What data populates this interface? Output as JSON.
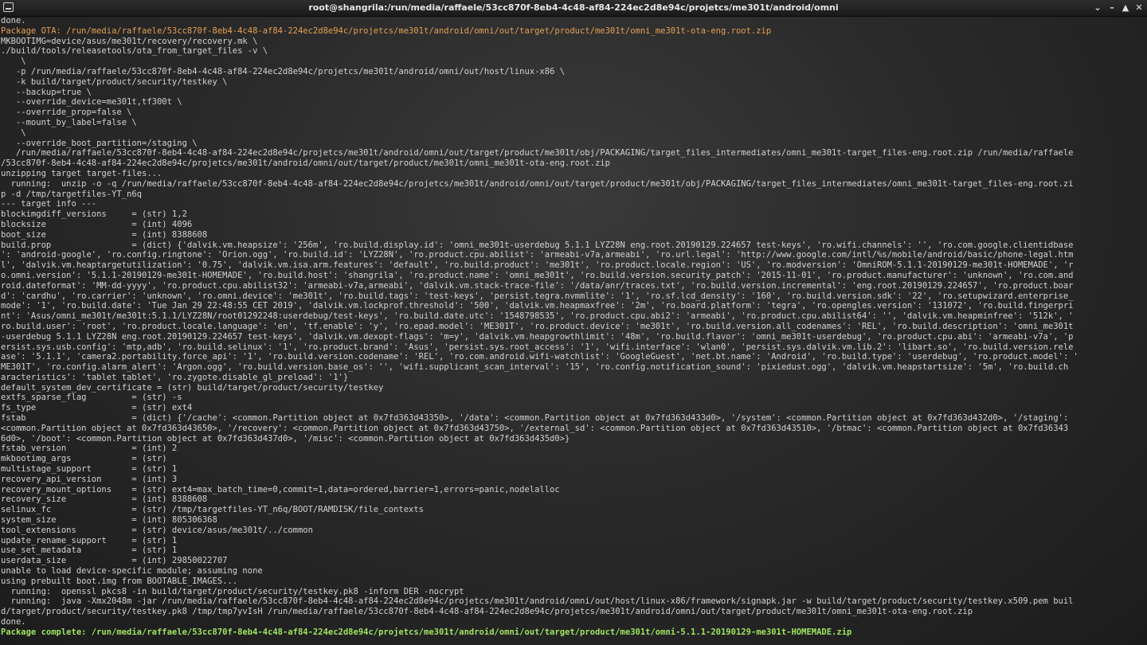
{
  "window": {
    "title": "root@shangrila:/run/media/raffaele/53cc870f-8eb4-4c48-af84-224ec2d8e94c/projetcs/me301t/android/omni",
    "icons": {
      "app": "terminal-icon",
      "menu": "chevron-down-icon",
      "minimize": "minimize-icon",
      "maximize": "maximize-icon",
      "close": "close-icon"
    },
    "glyphs": {
      "menu": "⌄",
      "minimize": "–",
      "maximize": "▲",
      "close": "✕"
    }
  },
  "colors": {
    "text": "#d2d2d2",
    "highlight_orange": "#e5a055",
    "highlight_green": "#9fe560",
    "background": "#2a2a2a"
  },
  "terminal": {
    "lines": [
      {
        "text": "done.",
        "style": "normal"
      },
      {
        "text": "Package OTA: /run/media/raffaele/53cc870f-8eb4-4c48-af84-224ec2d8e94c/projetcs/me301t/android/omni/out/target/product/me301t/omni_me301t-ota-eng.root.zip",
        "style": "orange"
      },
      {
        "text": "MKBOOTIMG=device/asus/me301t/recovery/recovery.mk \\",
        "style": "normal"
      },
      {
        "text": "./build/tools/releasetools/ota_from_target_files -v \\",
        "style": "normal"
      },
      {
        "text": "    \\",
        "style": "normal"
      },
      {
        "text": "   -p /run/media/raffaele/53cc870f-8eb4-4c48-af84-224ec2d8e94c/projetcs/me301t/android/omni/out/host/linux-x86 \\",
        "style": "normal"
      },
      {
        "text": "   -k build/target/product/security/testkey \\",
        "style": "normal"
      },
      {
        "text": "   --backup=true \\",
        "style": "normal"
      },
      {
        "text": "   --override_device=me301t,tf300t \\",
        "style": "normal"
      },
      {
        "text": "   --override_prop=false \\",
        "style": "normal"
      },
      {
        "text": "   --mount_by_label=false \\",
        "style": "normal"
      },
      {
        "text": "    \\",
        "style": "normal"
      },
      {
        "text": "   --override_boot_partition=/staging \\",
        "style": "normal"
      },
      {
        "text": "   /run/media/raffaele/53cc870f-8eb4-4c48-af84-224ec2d8e94c/projetcs/me301t/android/omni/out/target/product/me301t/obj/PACKAGING/target_files_intermediates/omni_me301t-target_files-eng.root.zip /run/media/raffaele",
        "style": "normal"
      },
      {
        "text": "/53cc870f-8eb4-4c48-af84-224ec2d8e94c/projetcs/me301t/android/omni/out/target/product/me301t/omni_me301t-ota-eng.root.zip",
        "style": "normal"
      },
      {
        "text": "unzipping target target-files...",
        "style": "normal"
      },
      {
        "text": "  running:  unzip -o -q /run/media/raffaele/53cc870f-8eb4-4c48-af84-224ec2d8e94c/projetcs/me301t/android/omni/out/target/product/me301t/obj/PACKAGING/target_files_intermediates/omni_me301t-target_files-eng.root.zi",
        "style": "normal"
      },
      {
        "text": "p -d /tmp/targetfiles-YT_n6q",
        "style": "normal"
      },
      {
        "text": "--- target info ---",
        "style": "normal"
      },
      {
        "text": "blockimgdiff_versions     = (str) 1,2",
        "style": "normal"
      },
      {
        "text": "blocksize                 = (int) 4096",
        "style": "normal"
      },
      {
        "text": "boot_size                 = (int) 8388608",
        "style": "normal"
      },
      {
        "text": "build.prop                = (dict) {'dalvik.vm.heapsize': '256m', 'ro.build.display.id': 'omni_me301t-userdebug 5.1.1 LYZ28N eng.root.20190129.224657 test-keys', 'ro.wifi.channels': '', 'ro.com.google.clientidbase",
        "style": "normal"
      },
      {
        "text": "': 'android-google', 'ro.config.ringtone': 'Orion.ogg', 'ro.build.id': 'LYZ28N', 'ro.product.cpu.abilist': 'armeabi-v7a,armeabi', 'ro.url.legal': 'http://www.google.com/intl/%s/mobile/android/basic/phone-legal.htm",
        "style": "normal"
      },
      {
        "text": "l', 'dalvik.vm.heaptargetutilization': '0.75', 'dalvik.vm.isa.arm.features': 'default', 'ro.build.product': 'me301t', 'ro.product.locale.region': 'US', 'ro.modversion': 'OmniROM-5.1.1-20190129-me301t-HOMEMADE', 'r",
        "style": "normal"
      },
      {
        "text": "o.omni.version': '5.1.1-20190129-me301t-HOMEMADE', 'ro.build.host': 'shangrila', 'ro.product.name': 'omni_me301t', 'ro.build.version.security_patch': '2015-11-01', 'ro.product.manufacturer': 'unknown', 'ro.com.and",
        "style": "normal"
      },
      {
        "text": "roid.dateformat': 'MM-dd-yyyy', 'ro.product.cpu.abilist32': 'armeabi-v7a,armeabi', 'dalvik.vm.stack-trace-file': '/data/anr/traces.txt', 'ro.build.version.incremental': 'eng.root.20190129.224657', 'ro.product.boar",
        "style": "normal"
      },
      {
        "text": "d': 'cardhu', 'ro.carrier': 'unknown', 'ro.omni.device': 'me301t', 'ro.build.tags': 'test-keys', 'persist.tegra.nvmmlite': '1', 'ro.sf.lcd_density': '160', 'ro.build.version.sdk': '22', 'ro.setupwizard.enterprise_",
        "style": "normal"
      },
      {
        "text": "mode': '1', 'ro.build.date': 'Tue Jan 29 22:48:55 CET 2019', 'dalvik.vm.lockprof.threshold': '500', 'dalvik.vm.heapmaxfree': '2m', 'ro.board.platform': 'tegra', 'ro.opengles.version': '131072', 'ro.build.fingerpri",
        "style": "normal"
      },
      {
        "text": "nt': 'Asus/omni_me301t/me301t:5.1.1/LYZ28N/root01292248:userdebug/test-keys', 'ro.build.date.utc': '1548798535', 'ro.product.cpu.abi2': 'armeabi', 'ro.product.cpu.abilist64': '', 'dalvik.vm.heapminfree': '512k', '",
        "style": "normal"
      },
      {
        "text": "ro.build.user': 'root', 'ro.product.locale.language': 'en', 'tf.enable': 'y', 'ro.epad.model': 'ME301T', 'ro.product.device': 'me301t', 'ro.build.version.all_codenames': 'REL', 'ro.build.description': 'omni_me301t",
        "style": "normal"
      },
      {
        "text": "-userdebug 5.1.1 LYZ28N eng.root.20190129.224657 test-keys', 'dalvik.vm.dexopt-flags': 'm=y', 'dalvik.vm.heapgrowthlimit': '48m', 'ro.build.flavor': 'omni_me301t-userdebug', 'ro.product.cpu.abi': 'armeabi-v7a', 'p",
        "style": "normal"
      },
      {
        "text": "ersist.sys.usb.config': 'mtp,adb', 'ro.build.selinux': '1', 'ro.product.brand': 'Asus', 'persist.sys.root_access': '1', 'wifi.interface': 'wlan0', 'persist.sys.dalvik.vm.lib.2': 'libart.so', 'ro.build.version.rele",
        "style": "normal"
      },
      {
        "text": "ase': '5.1.1', 'camera2.portability.force_api': '1', 'ro.build.version.codename': 'REL', 'ro.com.android.wifi-watchlist': 'GoogleGuest', 'net.bt.name': 'Android', 'ro.build.type': 'userdebug', 'ro.product.model': '",
        "style": "normal"
      },
      {
        "text": "ME301T', 'ro.config.alarm_alert': 'Argon.ogg', 'ro.build.version.base_os': '', 'wifi.supplicant_scan_interval': '15', 'ro.config.notification_sound': 'pixiedust.ogg', 'dalvik.vm.heapstartsize': '5m', 'ro.build.ch",
        "style": "normal"
      },
      {
        "text": "aracteristics': 'tablet tablet', 'ro.zygote.disable_gl_preload': '1'}",
        "style": "normal"
      },
      {
        "text": "default_system_dev_certificate = (str) build/target/product/security/testkey",
        "style": "normal"
      },
      {
        "text": "extfs_sparse_flag         = (str) -s",
        "style": "normal"
      },
      {
        "text": "fs_type                   = (str) ext4",
        "style": "normal"
      },
      {
        "text": "fstab                     = (dict) {'/cache': <common.Partition object at 0x7fd363d43350>, '/data': <common.Partition object at 0x7fd363d433d0>, '/system': <common.Partition object at 0x7fd363d432d0>, '/staging':",
        "style": "normal"
      },
      {
        "text": "<common.Partition object at 0x7fd363d43650>, '/recovery': <common.Partition object at 0x7fd363d43750>, '/external_sd': <common.Partition object at 0x7fd363d43510>, '/btmac': <common.Partition object at 0x7fd36343",
        "style": "normal"
      },
      {
        "text": "6d0>, '/boot': <common.Partition object at 0x7fd363d437d0>, '/misc': <common.Partition object at 0x7fd363d435d0>}",
        "style": "normal"
      },
      {
        "text": "fstab_version             = (int) 2",
        "style": "normal"
      },
      {
        "text": "mkbootimg_args            = (str)",
        "style": "normal"
      },
      {
        "text": "multistage_support        = (str) 1",
        "style": "normal"
      },
      {
        "text": "recovery_api_version      = (int) 3",
        "style": "normal"
      },
      {
        "text": "recovery_mount_options    = (str) ext4=max_batch_time=0,commit=1,data=ordered,barrier=1,errors=panic,nodelalloc",
        "style": "normal"
      },
      {
        "text": "recovery_size             = (int) 8388608",
        "style": "normal"
      },
      {
        "text": "selinux_fc                = (str) /tmp/targetfiles-YT_n6q/BOOT/RAMDISK/file_contexts",
        "style": "normal"
      },
      {
        "text": "system_size               = (int) 805306368",
        "style": "normal"
      },
      {
        "text": "tool_extensions           = (str) device/asus/me301t/../common",
        "style": "normal"
      },
      {
        "text": "update_rename_support     = (str) 1",
        "style": "normal"
      },
      {
        "text": "use_set_metadata          = (str) 1",
        "style": "normal"
      },
      {
        "text": "userdata_size             = (int) 29850022707",
        "style": "normal"
      },
      {
        "text": "unable to load device-specific module; assuming none",
        "style": "normal"
      },
      {
        "text": "using prebuilt boot.img from BOOTABLE_IMAGES...",
        "style": "normal"
      },
      {
        "text": "  running:  openssl pkcs8 -in build/target/product/security/testkey.pk8 -inform DER -nocrypt",
        "style": "normal"
      },
      {
        "text": "  running:  java -Xmx2048m -jar /run/media/raffaele/53cc870f-8eb4-4c48-af84-224ec2d8e94c/projetcs/me301t/android/omni/out/host/linux-x86/framework/signapk.jar -w build/target/product/security/testkey.x509.pem buil",
        "style": "normal"
      },
      {
        "text": "d/target/product/security/testkey.pk8 /tmp/tmp7yvIsH /run/media/raffaele/53cc870f-8eb4-4c48-af84-224ec2d8e94c/projetcs/me301t/android/omni/out/target/product/me301t/omni_me301t-ota-eng.root.zip",
        "style": "normal"
      },
      {
        "text": "done.",
        "style": "normal"
      },
      {
        "text": "Package complete: /run/media/raffaele/53cc870f-8eb4-4c48-af84-224ec2d8e94c/projetcs/me301t/android/omni/out/target/product/me301t/omni-5.1.1-20190129-me301t-HOMEMADE.zip",
        "style": "green"
      }
    ]
  }
}
